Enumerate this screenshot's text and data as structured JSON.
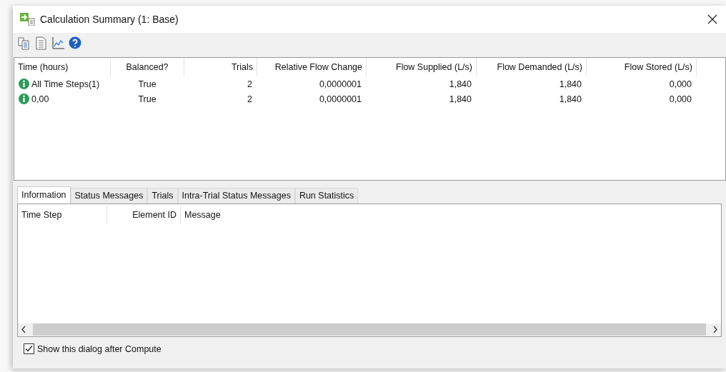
{
  "window": {
    "title": "Calculation Summary (1: Base)"
  },
  "toolbar": {
    "buttons": [
      {
        "kind": "copy"
      },
      {
        "kind": "report"
      },
      {
        "kind": "graph"
      },
      {
        "kind": "help"
      }
    ]
  },
  "summary_table": {
    "columns": [
      "Time (hours)",
      "Balanced?",
      "Trials",
      "Relative Flow Change",
      "Flow Supplied (L/s)",
      "Flow Demanded (L/s)",
      "Flow Stored (L/s)"
    ],
    "rows": [
      {
        "cells": [
          "All Time Steps(1)",
          "True",
          "2",
          "0,0000001",
          "1,840",
          "1,840",
          "0,000"
        ]
      },
      {
        "cells": [
          "0,00",
          "True",
          "2",
          "0,0000001",
          "1,840",
          "1,840",
          "0,000"
        ]
      }
    ]
  },
  "tabs": [
    {
      "label": "Information",
      "selected": true
    },
    {
      "label": "Status Messages",
      "selected": false
    },
    {
      "label": "Trials",
      "selected": false
    },
    {
      "label": "Intra-Trial Status Messages",
      "selected": false
    },
    {
      "label": "Run Statistics",
      "selected": false
    }
  ],
  "messages_table": {
    "columns": [
      "Time Step",
      "Element ID",
      "Message"
    ]
  },
  "show_after_compute": {
    "label": "Show this dialog after Compute",
    "checked": true
  }
}
